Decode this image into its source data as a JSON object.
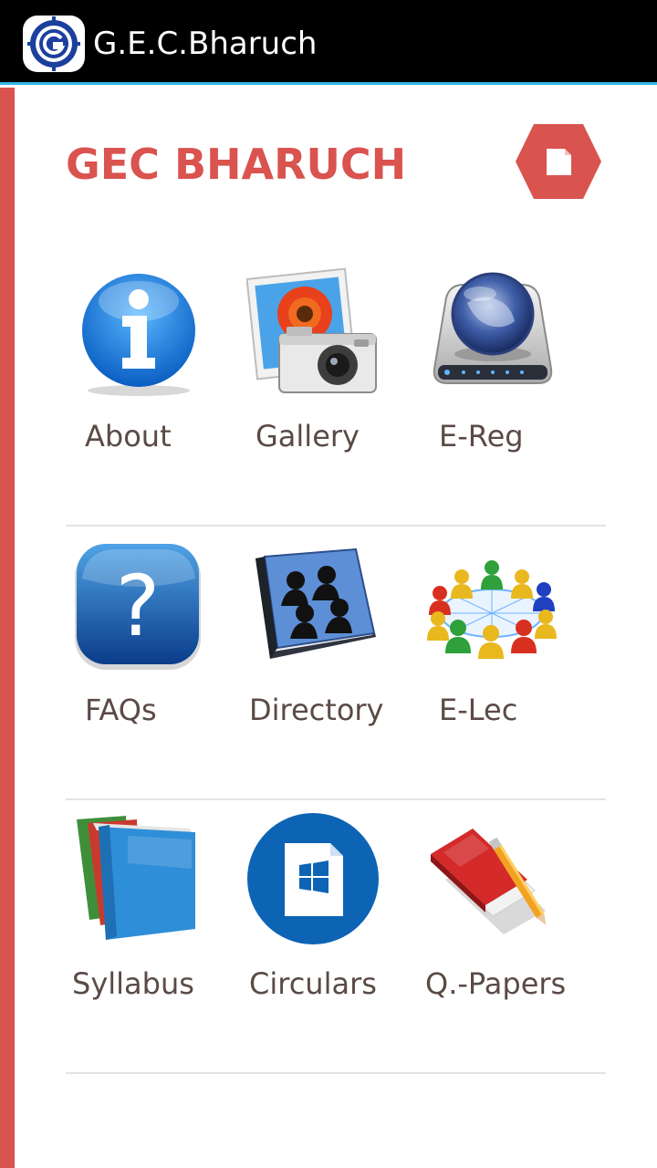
{
  "actionbar": {
    "title": "G.E.C.Bharuch",
    "logo_icon": "gec-logo-icon"
  },
  "header": {
    "brand": "GEC BHARUCH",
    "action_icon": "document-icon"
  },
  "colors": {
    "accent": "#d9534f",
    "actionbar_bg": "#000000",
    "actionbar_underline": "#33b5e5",
    "label_text": "#5a4a46"
  },
  "grid": {
    "rows": [
      [
        {
          "label": "About",
          "icon": "info-icon"
        },
        {
          "label": "Gallery",
          "icon": "photo-camera-icon"
        },
        {
          "label": "E-Reg",
          "icon": "globe-drive-icon"
        }
      ],
      [
        {
          "label": "FAQs",
          "icon": "question-icon"
        },
        {
          "label": "Directory",
          "icon": "address-book-icon"
        },
        {
          "label": "E-Lec",
          "icon": "people-network-icon"
        }
      ],
      [
        {
          "label": "Syllabus",
          "icon": "books-icon"
        },
        {
          "label": "Circulars",
          "icon": "windows-file-icon"
        },
        {
          "label": "Q.-Papers",
          "icon": "notebook-pencil-icon"
        }
      ]
    ]
  }
}
